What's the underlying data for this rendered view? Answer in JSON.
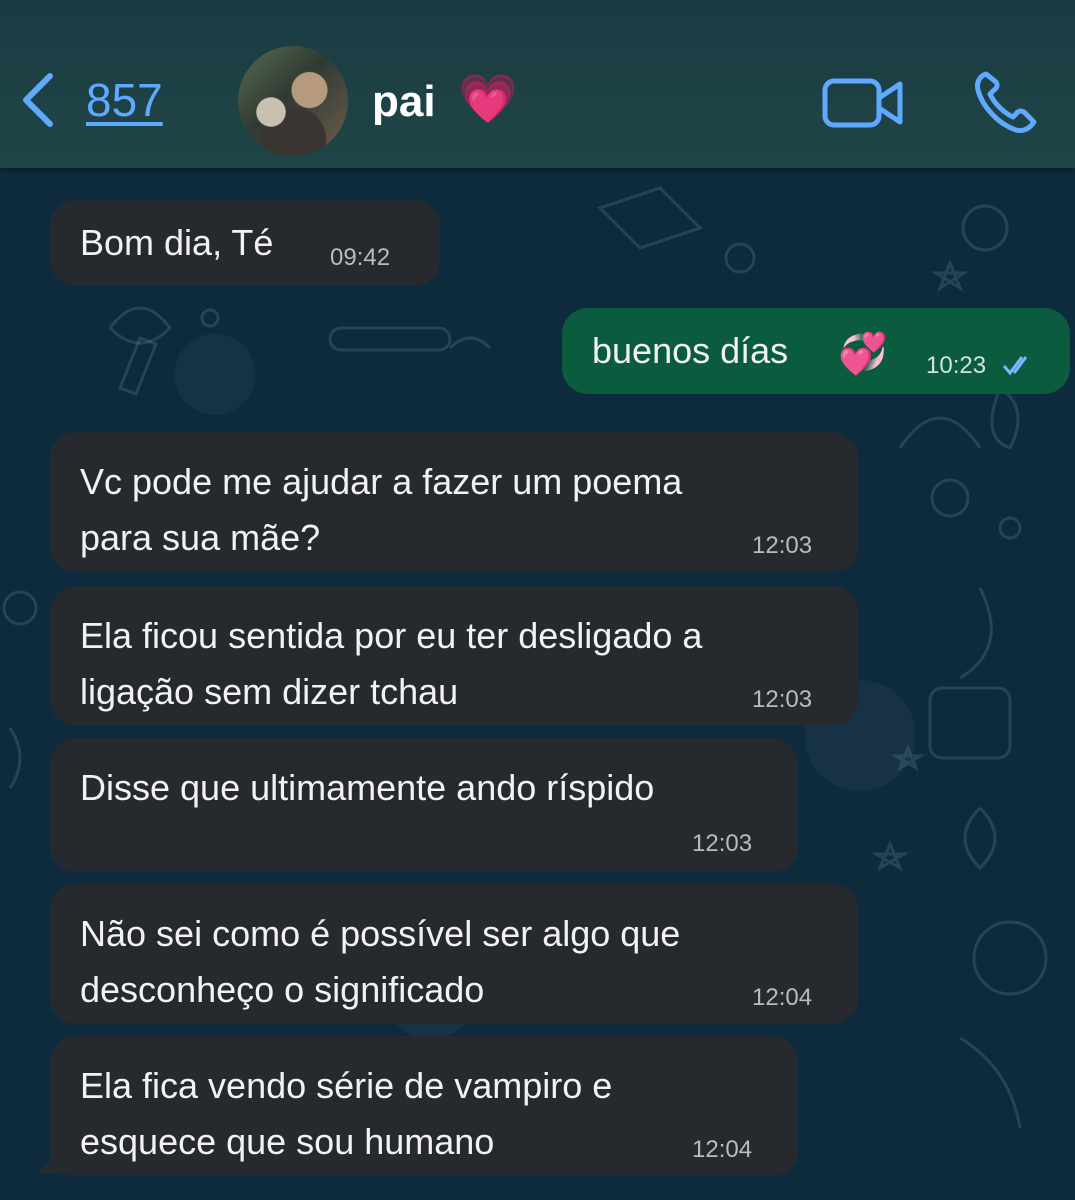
{
  "header": {
    "back_count": "857",
    "contact_name": "pai",
    "contact_emoji": "💗",
    "icons": [
      "chevron-left-icon",
      "video-call-icon",
      "phone-icon"
    ],
    "accent_color": "#5fa9ff"
  },
  "messages": [
    {
      "direction": "in",
      "text": "Bom dia, Té",
      "time": "09:42"
    },
    {
      "direction": "out",
      "text": "buenos días",
      "emoji": "💞",
      "time": "10:23",
      "status": "read"
    },
    {
      "direction": "in",
      "text": "Vc pode me ajudar a fazer um poema\npara sua mãe?",
      "time": "12:03"
    },
    {
      "direction": "in",
      "text": "Ela ficou sentida por eu ter desligado a\nligação sem dizer tchau",
      "time": "12:03"
    },
    {
      "direction": "in",
      "text": "Disse que ultimamente ando ríspido",
      "time": "12:03"
    },
    {
      "direction": "in",
      "text": "Não sei como é possível ser algo que\ndesconheço o significado",
      "time": "12:04"
    },
    {
      "direction": "in",
      "text": "Ela fica vendo série de vampiro e\nesquece que sou humano",
      "time": "12:04"
    }
  ],
  "colors": {
    "incoming_bubble": "#262a2e",
    "outgoing_bubble": "#0b5b3e",
    "chat_background": "#0e2b3e",
    "header_background": "#1f4646"
  }
}
